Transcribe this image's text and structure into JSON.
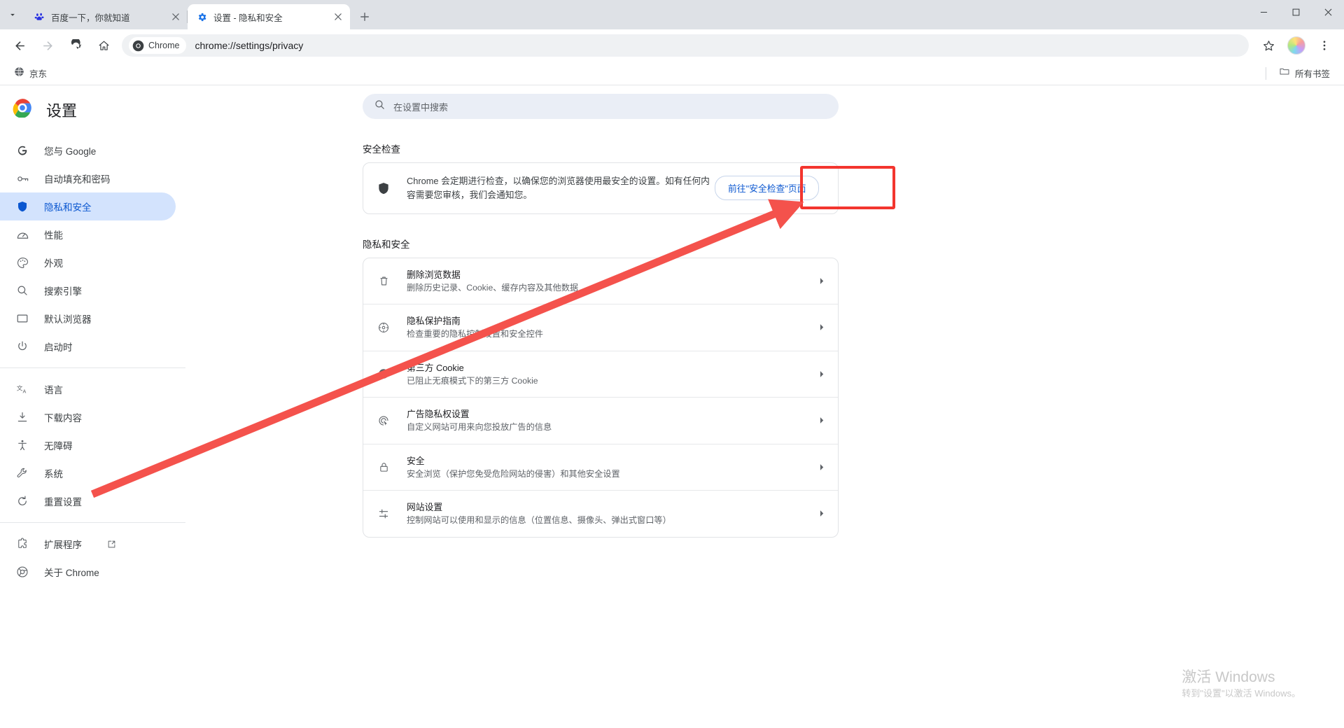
{
  "window": {
    "minimize_label": "最小化",
    "maximize_label": "最大化",
    "close_label": "关闭"
  },
  "tabs": [
    {
      "title": "百度一下，你就知道",
      "favicon": "baidu-paw-icon",
      "active": false
    },
    {
      "title": "设置 - 隐私和安全",
      "favicon": "gear-icon",
      "active": true
    }
  ],
  "tabstrip": {
    "tab_search_label": "搜索标签页",
    "new_tab_label": "新建标签页"
  },
  "toolbar": {
    "back_label": "返回",
    "forward_label": "前进",
    "reload_label": "重新加载",
    "home_label": "主页",
    "chrome_chip_label": "Chrome",
    "url": "chrome://settings/privacy",
    "bookmark_label": "收藏",
    "profile_label": "个人资料",
    "menu_label": "自定义及控制"
  },
  "bookmarks": {
    "items": [
      {
        "label": "京东",
        "icon": "globe-icon"
      }
    ],
    "all_bookmarks_label": "所有书签",
    "all_bookmarks_icon": "folder-icon"
  },
  "sidebar": {
    "app_title": "设置",
    "logo": "chrome-logo-icon",
    "groups": [
      {
        "items": [
          {
            "label": "您与 Google",
            "icon": "google-g-icon",
            "selected": false
          },
          {
            "label": "自动填充和密码",
            "icon": "key-icon",
            "selected": false
          },
          {
            "label": "隐私和安全",
            "icon": "shield-icon",
            "selected": true
          },
          {
            "label": "性能",
            "icon": "speedometer-icon",
            "selected": false
          },
          {
            "label": "外观",
            "icon": "palette-icon",
            "selected": false
          },
          {
            "label": "搜索引擎",
            "icon": "search-icon",
            "selected": false
          },
          {
            "label": "默认浏览器",
            "icon": "browser-window-icon",
            "selected": false
          },
          {
            "label": "启动时",
            "icon": "power-icon",
            "selected": false
          }
        ]
      },
      {
        "items": [
          {
            "label": "语言",
            "icon": "translate-icon",
            "selected": false
          },
          {
            "label": "下载内容",
            "icon": "download-icon",
            "selected": false
          },
          {
            "label": "无障碍",
            "icon": "accessibility-icon",
            "selected": false
          },
          {
            "label": "系统",
            "icon": "wrench-icon",
            "selected": false
          },
          {
            "label": "重置设置",
            "icon": "refresh-icon",
            "selected": false
          }
        ]
      },
      {
        "items": [
          {
            "label": "扩展程序",
            "icon": "extension-icon",
            "selected": false,
            "external": true,
            "external_icon": "open-in-new-icon"
          },
          {
            "label": "关于 Chrome",
            "icon": "chrome-outline-icon",
            "selected": false
          }
        ]
      }
    ]
  },
  "search": {
    "placeholder": "在设置中搜索",
    "icon": "search-icon"
  },
  "main": {
    "safety_check": {
      "section_title": "安全检查",
      "icon": "shield-icon",
      "description": "Chrome 会定期进行检查，以确保您的浏览器使用最安全的设置。如有任何内容需要您审核，我们会通知您。",
      "button_label": "前往\"安全检查\"页面"
    },
    "privacy": {
      "section_title": "隐私和安全",
      "rows": [
        {
          "title": "删除浏览数据",
          "subtitle": "删除历史记录、Cookie、缓存内容及其他数据",
          "icon": "trash-icon",
          "arrow": "chevron-right-icon"
        },
        {
          "title": "隐私保护指南",
          "subtitle": "检查重要的隐私控制设置和安全控件",
          "icon": "privacy-guide-icon",
          "arrow": "chevron-right-icon"
        },
        {
          "title": "第三方 Cookie",
          "subtitle": "已阻止无痕模式下的第三方 Cookie",
          "icon": "cookie-icon",
          "arrow": "chevron-right-icon"
        },
        {
          "title": "广告隐私权设置",
          "subtitle": "自定义网站可用来向您投放广告的信息",
          "icon": "ad-privacy-icon",
          "arrow": "chevron-right-icon"
        },
        {
          "title": "安全",
          "subtitle": "安全浏览（保护您免受危险网站的侵害）和其他安全设置",
          "icon": "lock-icon",
          "arrow": "chevron-right-icon"
        },
        {
          "title": "网站设置",
          "subtitle": "控制网站可以使用和显示的信息（位置信息、摄像头、弹出式窗口等）",
          "icon": "sliders-icon",
          "arrow": "chevron-right-icon"
        }
      ]
    }
  },
  "annotation": {
    "highlight_color": "#f3352e",
    "arrow_color": "#f4524c",
    "target": "前往\"安全检查\"页面"
  },
  "watermark": {
    "line1": "激活 Windows",
    "line2": "转到\"设置\"以激活 Windows。"
  }
}
